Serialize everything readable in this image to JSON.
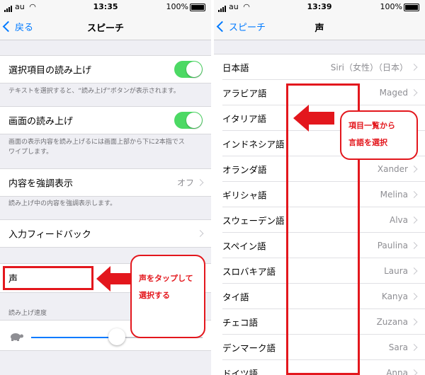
{
  "left": {
    "status": {
      "carrier": "au",
      "time": "13:35",
      "battery": "100%"
    },
    "nav": {
      "back_label": "戻る",
      "title": "スピーチ"
    },
    "speak_selection": {
      "label": "選択項目の読み上げ",
      "on": true,
      "footer": "テキストを選択すると、“読み上げ”ボタンが表示されます。"
    },
    "speak_screen": {
      "label": "画面の読み上げ",
      "on": true,
      "footer_line1": "画面の表示内容を読み上げるには画面上部から下に2本指でス",
      "footer_line2": "ワイプします。"
    },
    "highlight": {
      "label": "内容を強調表示",
      "value": "オフ",
      "footer": "読み上げ中の内容を強調表示します。"
    },
    "typing_feedback": {
      "label": "入力フィードバック"
    },
    "voice": {
      "label": "声"
    },
    "rate": {
      "header": "読み上げ速度",
      "level": 0.5
    },
    "callout": {
      "line1": "声をタップして",
      "line2": "選択する"
    }
  },
  "right": {
    "status": {
      "carrier": "au",
      "time": "13:39",
      "battery": "100%"
    },
    "nav": {
      "back_label": "スピーチ",
      "title": "声"
    },
    "japanese": {
      "label": "日本語",
      "value": "Siri（女性）（日本）"
    },
    "languages": [
      {
        "label": "アラビア語",
        "value": "Maged"
      },
      {
        "label": "イタリア語",
        "value": ""
      },
      {
        "label": "インドネシア語",
        "value": ""
      },
      {
        "label": "オランダ語",
        "value": "Xander"
      },
      {
        "label": "ギリシャ語",
        "value": "Melina"
      },
      {
        "label": "スウェーデン語",
        "value": "Alva"
      },
      {
        "label": "スペイン語",
        "value": "Paulina"
      },
      {
        "label": "スロバキア語",
        "value": "Laura"
      },
      {
        "label": "タイ語",
        "value": "Kanya"
      },
      {
        "label": "チェコ語",
        "value": "Zuzana"
      },
      {
        "label": "デンマーク語",
        "value": "Sara"
      },
      {
        "label": "ドイツ語",
        "value": "Anna"
      }
    ],
    "callout": {
      "line1": "項目一覧から",
      "line2": "言語を選択"
    }
  },
  "colors": {
    "accent": "#007aff",
    "toggle_on": "#4cd964",
    "annotation": "#e3171d"
  },
  "icons": {
    "back": "chevron-left-icon",
    "disclosure": "chevron-right-icon",
    "rate_slow": "turtle-icon",
    "wifi": "wifi-icon",
    "battery": "battery-icon"
  }
}
